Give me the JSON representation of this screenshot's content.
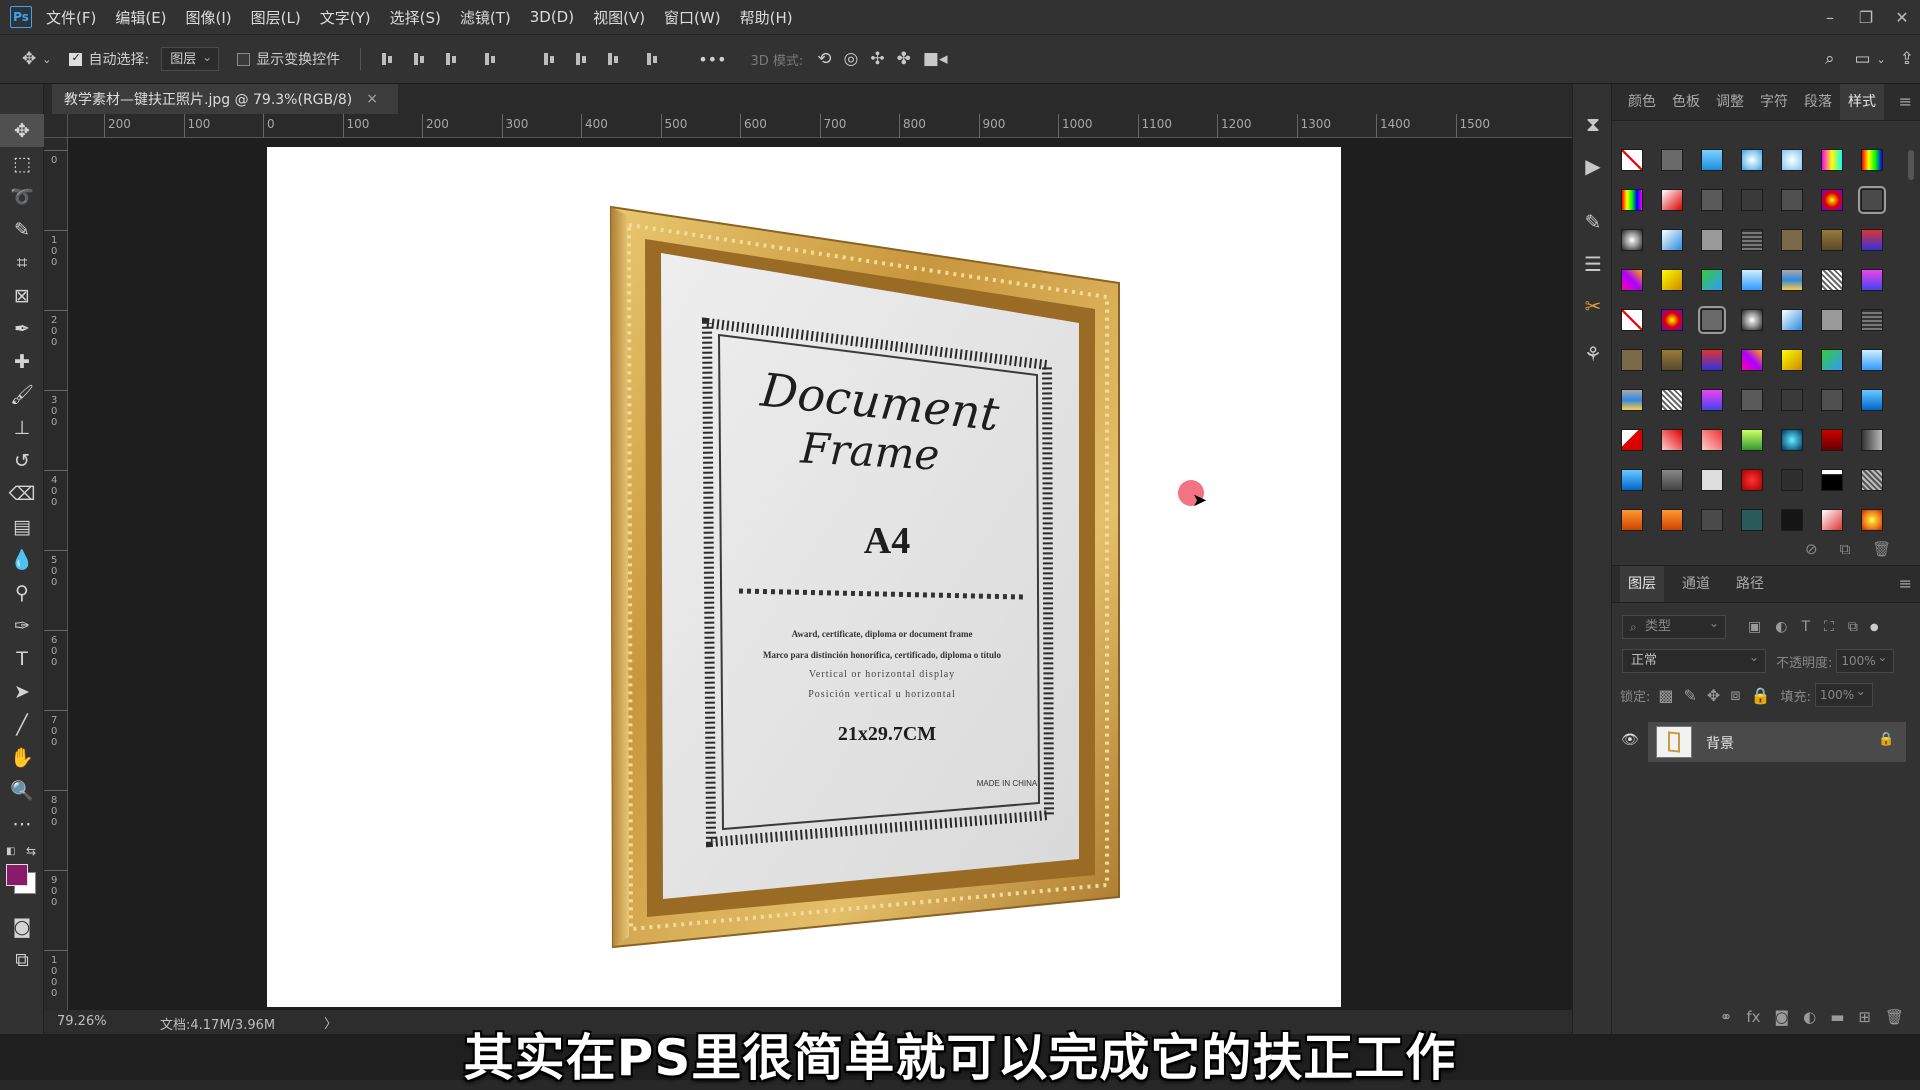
{
  "app": {
    "logo": "Ps"
  },
  "menu": [
    "文件(F)",
    "编辑(E)",
    "图像(I)",
    "图层(L)",
    "文字(Y)",
    "选择(S)",
    "滤镜(T)",
    "3D(D)",
    "视图(V)",
    "窗口(W)",
    "帮助(H)"
  ],
  "window_controls": {
    "minimize": "–",
    "restore": "❐",
    "close": "✕"
  },
  "options": {
    "auto_select_label": "自动选择:",
    "auto_select_target": "图层",
    "show_transform_label": "显示变换控件",
    "more": "•••",
    "mode_3d_label": "3D 模式:"
  },
  "document": {
    "tab_title": "教学素材—键扶正照片.jpg @ 79.3%(RGB/8)",
    "close": "×"
  },
  "ruler": {
    "h_labels": [
      "200",
      "100",
      "0",
      "100",
      "200",
      "300",
      "400",
      "500",
      "600",
      "700",
      "800",
      "900",
      "1000",
      "1100",
      "1200",
      "1300",
      "1400",
      "1500"
    ],
    "v_labels": [
      "0",
      "100",
      "200",
      "300",
      "400",
      "500",
      "600",
      "700",
      "800",
      "900",
      "1000"
    ]
  },
  "frame_doc": {
    "title_line1": "Document",
    "title_line2": "Frame",
    "size": "A4",
    "line1": "Award, certificate, diploma or document frame",
    "line2": "Marco para distinción honorífica, certificado, diploma o título",
    "line3": "Vertical or horizontal display",
    "line4": "Posición vertical u horizontal",
    "dims": "21x29.7CM",
    "origin": "MADE IN CHINA"
  },
  "status": {
    "zoom": "79.26%",
    "doc": "文档:4.17M/3.96M",
    "arrow": "〉"
  },
  "panel_tabs": [
    "颜色",
    "色板",
    "调整",
    "字符",
    "段落",
    "样式"
  ],
  "panel_active_tab": "样式",
  "layers": {
    "tabs": [
      "图层",
      "通道",
      "路径"
    ],
    "filter_placeholder": "类型",
    "blend_mode": "正常",
    "opacity_label": "不透明度:",
    "opacity_value": "100%",
    "lock_label": "锁定:",
    "fill_label": "填充:",
    "fill_value": "100%",
    "items": [
      {
        "name": "背景",
        "visible": true,
        "locked": true
      }
    ]
  },
  "subtitle": "其实在PS里很简单就可以完成它的扶正工作",
  "colors": {
    "foreground": "#8a1a6a",
    "background": "#ffffff",
    "accent": "#31a8ff"
  }
}
